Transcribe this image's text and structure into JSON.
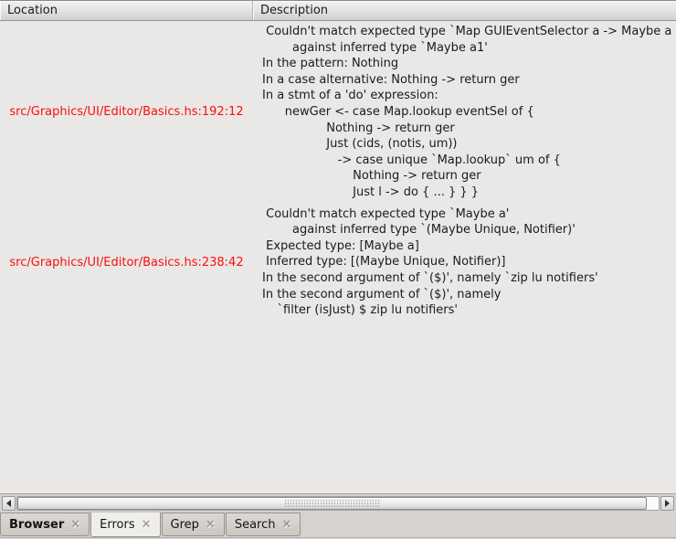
{
  "panel": {
    "columns": [
      {
        "label": "Location"
      },
      {
        "label": "Description"
      }
    ],
    "rows": [
      {
        "location": "src/Graphics/UI/Editor/Basics.hs:192:12",
        "lines": [
          {
            "indent": 1,
            "text": "Couldn't match expected type `Map GUIEventSelector a -> Maybe a"
          },
          {
            "indent": 8,
            "text": "against inferred type `Maybe a1'"
          },
          {
            "indent": 0,
            "text": "In the pattern: Nothing"
          },
          {
            "indent": 0,
            "text": "In a case alternative: Nothing -> return ger"
          },
          {
            "indent": 0,
            "text": "In a stmt of a 'do' expression:"
          },
          {
            "indent": 6,
            "text": "newGer <- case Map.lookup eventSel of {"
          },
          {
            "indent": 17,
            "text": "Nothing -> return ger"
          },
          {
            "indent": 17,
            "text": "Just (cids, (notis, um))"
          },
          {
            "indent": 20,
            "text": "-> case unique `Map.lookup` um of {"
          },
          {
            "indent": 24,
            "text": "Nothing -> return ger"
          },
          {
            "indent": 24,
            "text": "Just l -> do { ... } } }"
          }
        ]
      },
      {
        "location": "src/Graphics/UI/Editor/Basics.hs:238:42",
        "lines": [
          {
            "indent": 1,
            "text": "Couldn't match expected type `Maybe a'"
          },
          {
            "indent": 8,
            "text": "against inferred type `(Maybe Unique, Notifier)'"
          },
          {
            "indent": 1,
            "text": "Expected type: [Maybe a]"
          },
          {
            "indent": 1,
            "text": "Inferred type: [(Maybe Unique, Notifier)]"
          },
          {
            "indent": 0,
            "text": "In the second argument of `($)', namely `zip lu notifiers'"
          },
          {
            "indent": 0,
            "text": "In the second argument of `($)', namely"
          },
          {
            "indent": 4,
            "text": "`filter (isJust) $ zip lu notifiers'"
          }
        ]
      }
    ]
  },
  "tabs": [
    {
      "label": "Browser",
      "bold": true,
      "selected": false
    },
    {
      "label": "Errors",
      "bold": false,
      "selected": true
    },
    {
      "label": "Grep",
      "bold": false,
      "selected": false
    },
    {
      "label": "Search",
      "bold": false,
      "selected": false
    }
  ],
  "icons": {
    "close": "✕",
    "scroll_left": "left-triangle",
    "scroll_right": "right-triangle"
  },
  "colors": {
    "location_text": "#f90e0e",
    "description_text": "#1b1b1b",
    "list_background": "#e9e8e6",
    "chrome_background": "#d6d3ce",
    "selected_tab_background": "#f0eeeb"
  }
}
